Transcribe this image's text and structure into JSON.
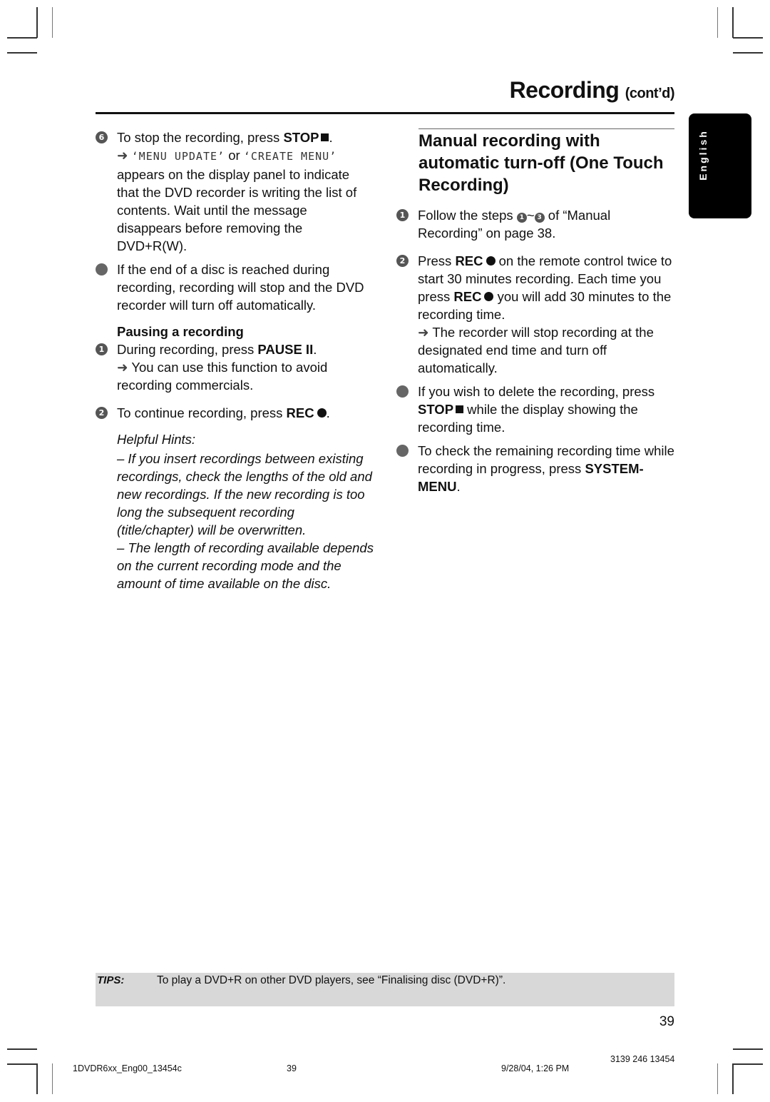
{
  "header": {
    "title": "Recording",
    "subtitle": "(cont’d)"
  },
  "language_tab": "English",
  "left_column": {
    "step6": {
      "marker": "6",
      "text_before": "To stop the recording, press ",
      "key": "STOP",
      "key_icon": "stop-square-icon",
      "after": ".",
      "arrow": "➜",
      "lcd1": "‘MENU UPDATE’",
      "or": " or ",
      "lcd2": "‘CREATE MENU’",
      "continuation": "appears on the display panel to indicate that the DVD recorder is writing the list of contents. Wait until the message disappears before removing the DVD+R(W)."
    },
    "bullet1": "If the end of a disc is reached during recording, recording will stop and the DVD recorder will turn off automatically.",
    "pausing": {
      "heading": "Pausing a recording",
      "step1": {
        "marker": "1",
        "text_before": "During recording, press ",
        "key": "PAUSE II",
        "after": ".",
        "arrow": "➜",
        "note": " You can use this function to avoid recording commercials."
      },
      "step2": {
        "marker": "2",
        "text_before": "To continue recording, press ",
        "key": "REC",
        "key_icon": "record-dot-icon",
        "after": "."
      }
    },
    "hints": {
      "title": "Helpful Hints:",
      "items": [
        "–  If you insert recordings between existing recordings, check the lengths of the old and new recordings. If the new recording is too long the subsequent recording (title/chapter) will be overwritten.",
        "–  The length of recording available depends on the current recording mode and the amount of time available on the disc."
      ]
    }
  },
  "right_column": {
    "section_title": "Manual recording with automatic turn-off (One Touch Recording)",
    "step1": {
      "marker": "1",
      "text_before": "Follow the steps ",
      "range_start": "1",
      "tilde": "~",
      "range_end": "3",
      "text_after": " of “Manual Recording” on page 38."
    },
    "step2": {
      "marker": "2",
      "t1": "Press ",
      "key1": "REC",
      "t2": " on the remote control twice to start 30 minutes recording. Each time you press ",
      "key2": "REC",
      "t3": " you will add 30 minutes to the recording time.",
      "arrow": "➜",
      "note": " The recorder will stop recording at the designated end time and turn off automatically."
    },
    "bullet1": {
      "t1": "If you wish to delete the recording, press ",
      "key": "STOP",
      "t2": " while the display showing the recording time."
    },
    "bullet2": {
      "t1": "To check the remaining recording time while recording in progress, press ",
      "key": "SYSTEM-MENU",
      "t2": "."
    }
  },
  "tips": {
    "label": "TIPS:",
    "text": "To play a DVD+R on other DVD players, see “Finalising disc (DVD+R)”."
  },
  "page_number": "39",
  "footer": {
    "file": "1DVDR6xx_Eng00_13454c",
    "page": "39",
    "timestamp": "9/28/04, 1:26 PM",
    "code": "3139 246 13454"
  }
}
